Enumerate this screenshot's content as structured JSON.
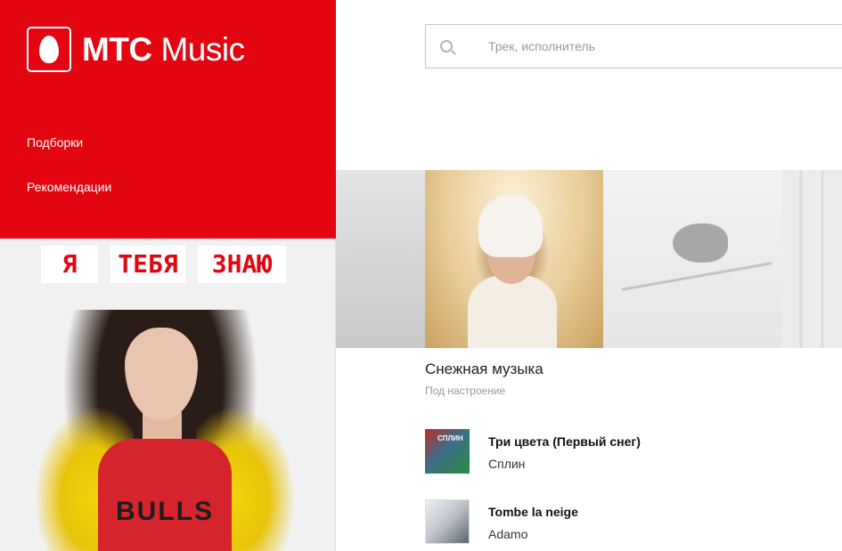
{
  "app": {
    "brand_bold": "МТС",
    "brand_light": "Music"
  },
  "nav": {
    "items": [
      {
        "label": "Подборки"
      },
      {
        "label": "Рекомендации"
      }
    ]
  },
  "promo": {
    "words": [
      "Я",
      "ТЕБЯ",
      "ЗНАЮ"
    ],
    "shirt_text": "BULLS"
  },
  "search": {
    "placeholder": "Трек, исполнитель",
    "value": ""
  },
  "playlist": {
    "title": "Снежная музыка",
    "subtitle": "Под настроение"
  },
  "tracks": [
    {
      "title": "Три цвета (Первый снег)",
      "artist": "Сплин",
      "cover_label": "СПЛИН"
    },
    {
      "title": "Tombe la neige",
      "artist": "Adamo"
    }
  ],
  "colors": {
    "brand_red": "#e30611",
    "text_dark": "#222222",
    "text_muted": "#999999"
  },
  "icons": {
    "search": "search-icon",
    "logo": "mts-egg-logo-icon"
  }
}
